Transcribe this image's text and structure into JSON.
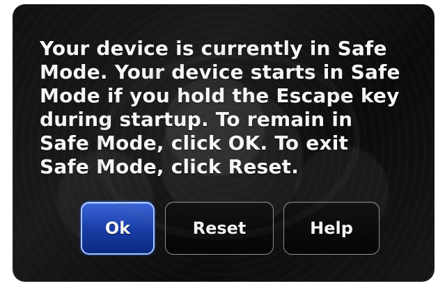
{
  "dialog": {
    "message": "Your device is currently in Safe\nMode. Your device starts in Safe\nMode if you hold the Escape key\nduring startup. To remain in\nSafe Mode, click OK. To exit\nSafe Mode, click Reset.",
    "buttons": {
      "ok": "Ok",
      "reset": "Reset",
      "help": "Help"
    }
  },
  "colors": {
    "primary_button": "#173ca4",
    "text": "#f6f6f6",
    "screen_bg": "#111111"
  }
}
